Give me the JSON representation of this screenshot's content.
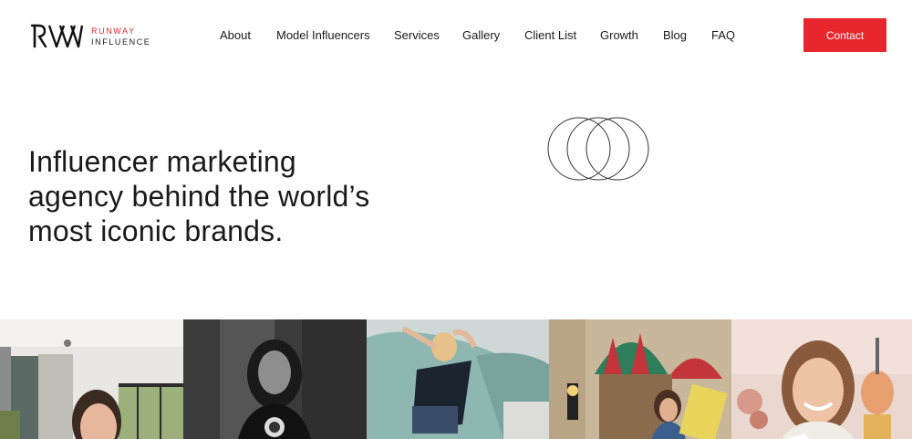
{
  "brand": {
    "line1": "RUNWAY",
    "line2": "INFLUENCE",
    "accent": "#e8262d"
  },
  "nav": {
    "items": [
      {
        "label": "About"
      },
      {
        "label": "Model Influencers"
      },
      {
        "label": "Services"
      },
      {
        "label": "Gallery"
      },
      {
        "label": "Client List"
      },
      {
        "label": "Growth"
      },
      {
        "label": "Blog"
      },
      {
        "label": "FAQ"
      }
    ],
    "contact_label": "Contact"
  },
  "hero": {
    "title_line1": "Influencer marketing",
    "title_line2": "agency behind the world’s",
    "title_line3": "most iconic brands."
  },
  "gallery": {
    "images": [
      {
        "name": "woman-indoor-home-photo"
      },
      {
        "name": "woman-black-and-white-photo"
      },
      {
        "name": "woman-on-sofa-photo"
      },
      {
        "name": "woman-street-cafe-photo"
      },
      {
        "name": "woman-smiling-festival-photo"
      }
    ]
  }
}
